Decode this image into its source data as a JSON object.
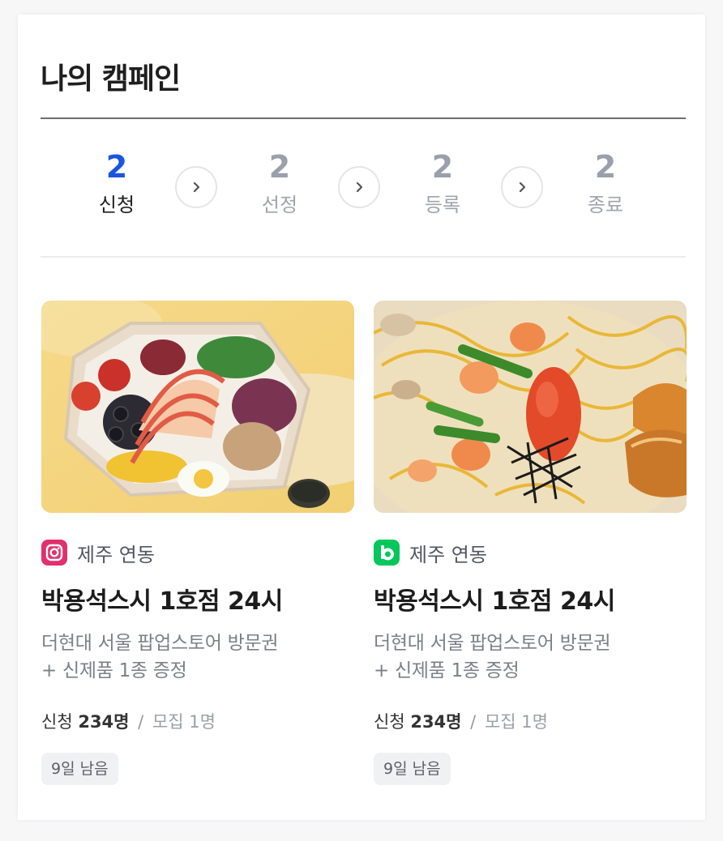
{
  "header": {
    "title": "나의 캠페인"
  },
  "steps": [
    {
      "count": "2",
      "label": "신청",
      "active": true
    },
    {
      "count": "2",
      "label": "선정",
      "active": false
    },
    {
      "count": "2",
      "label": "등록",
      "active": false
    },
    {
      "count": "2",
      "label": "종료",
      "active": false
    }
  ],
  "campaigns": [
    {
      "platform": "instagram-icon",
      "location": "제주 연동",
      "title": "박용석스시 1호점 24시",
      "desc_line1": "더현대 서울 팝업스토어 방문권",
      "desc_line2": "+ 신제품 1종  증정",
      "applied_label": "신청",
      "applied_count": "234명",
      "separator": "/",
      "recruit": "모집 1명",
      "remaining": "9일 남음"
    },
    {
      "platform": "blog-icon",
      "location": "제주 연동",
      "title": "박용석스시 1호점 24시",
      "desc_line1": "더현대 서울 팝업스토어 방문권",
      "desc_line2": "+ 신제품 1종  증정",
      "applied_label": "신청",
      "applied_count": "234명",
      "separator": "/",
      "recruit": "모집 1명",
      "remaining": "9일 남음"
    }
  ],
  "colors": {
    "accent": "#1a55e0",
    "instagram": "#e1306c",
    "blog": "#03c75a"
  }
}
